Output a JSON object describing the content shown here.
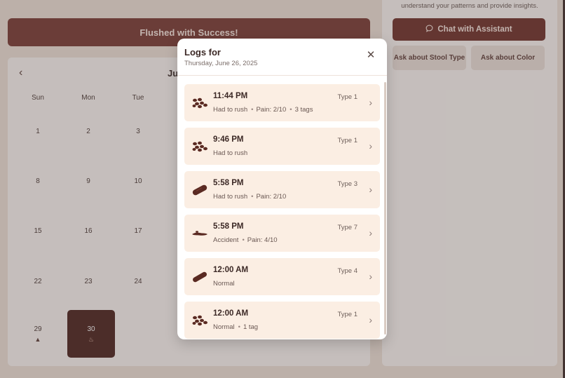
{
  "banner": {
    "text": "Flushed with Success!"
  },
  "calendar": {
    "month_label": "Ju",
    "weekdays": [
      "Sun",
      "Mon",
      "Tue"
    ],
    "rows": [
      [
        "1",
        "2",
        "3"
      ],
      [
        "8",
        "9",
        "10"
      ],
      [
        "15",
        "16",
        "17"
      ],
      [
        "22",
        "23",
        "24"
      ],
      [
        "29",
        "30",
        ""
      ]
    ],
    "marked_day_29": "▲",
    "marked_day_30": "♨"
  },
  "assistant": {
    "insight_text": "understand your patterns and provide insights.",
    "chat_label": "Chat with Assistant",
    "ask_stool_label": "Ask about Stool Type",
    "ask_color_label": "Ask about Color"
  },
  "modal": {
    "title": "Logs for",
    "subtitle": "Thursday, June 26, 2025",
    "close_glyph": "✕",
    "logs": [
      {
        "time": "11:44 PM",
        "type": "Type 1",
        "icon": "pellets-icon",
        "meta": [
          "Had to rush",
          "Pain: 2/10",
          "3 tags"
        ]
      },
      {
        "time": "9:46 PM",
        "type": "Type 1",
        "icon": "pellets-icon",
        "meta": [
          "Had to rush"
        ]
      },
      {
        "time": "5:58 PM",
        "type": "Type 3",
        "icon": "sausage-icon",
        "meta": [
          "Had to rush",
          "Pain: 2/10"
        ]
      },
      {
        "time": "5:58 PM",
        "type": "Type 7",
        "icon": "liquid-icon",
        "meta": [
          "Accident",
          "Pain: 4/10"
        ]
      },
      {
        "time": "12:00 AM",
        "type": "Type 4",
        "icon": "smooth-icon",
        "meta": [
          "Normal"
        ]
      },
      {
        "time": "12:00 AM",
        "type": "Type 1",
        "icon": "pellets-icon",
        "meta": [
          "Normal",
          "1 tag"
        ]
      }
    ]
  },
  "colors": {
    "primary": "#7a3a32",
    "selected_day": "#4b211c",
    "log_bg": "#fbeee3",
    "stool_brown": "#5a2a22"
  }
}
